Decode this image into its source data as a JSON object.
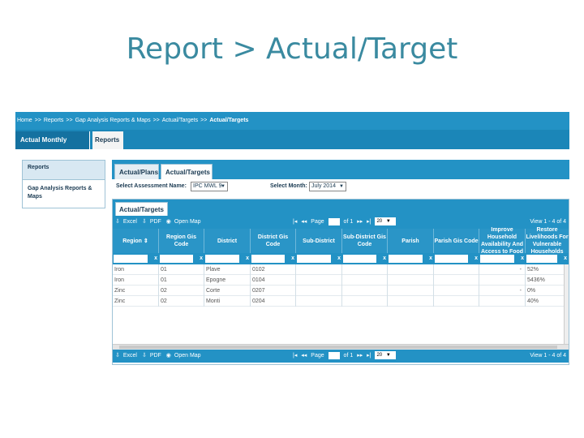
{
  "slide": {
    "title": "Report  > Actual/Target"
  },
  "breadcrumb": [
    "Home",
    "Reports",
    "Gap Analysis Reports & Maps",
    "Actual/Targets",
    "Actual/Targets"
  ],
  "main_tabs": [
    "Actual Monthly Update",
    "Reports"
  ],
  "sidebar": {
    "items": [
      "Reports",
      "Gap Analysis Reports & Maps"
    ]
  },
  "sub_tabs": [
    "Actual/Plans",
    "Actual/Targets"
  ],
  "filters": {
    "assessment_label": "Select Assessment Name:",
    "assessment_value": "IPC MWL 9",
    "month_label": "Select Month:",
    "month_value": "July 2014"
  },
  "grid": {
    "caption": "Actual/Targets",
    "toolbar": {
      "excel": "Excel",
      "pdf": "PDF",
      "open_map": "Open Map",
      "page_label": "Page",
      "of_label": "of 1",
      "page_size": "20",
      "view_label": "View 1 - 4 of 4"
    },
    "columns": [
      "Region",
      "Region Gis Code",
      "District",
      "District Gis Code",
      "Sub-District",
      "Sub-District Gis Code",
      "Parish",
      "Parish Gis Code",
      "Improve Household Availability And Access to Food",
      "Restore Livelihoods For Vulnerable Households"
    ],
    "filter_clear": "x",
    "rows": [
      [
        "Iron",
        "01",
        "Plave",
        "0102",
        "",
        "",
        "",
        "",
        "-",
        "52%"
      ],
      [
        "Iron",
        "01",
        "Epogne",
        "0104",
        "",
        "",
        "",
        "",
        "",
        "5436%"
      ],
      [
        "Zinc",
        "02",
        "Corte",
        "0207",
        "",
        "",
        "",
        "",
        "-",
        "0%"
      ],
      [
        "Zinc",
        "02",
        "Monti",
        "0204",
        "",
        "",
        "",
        "",
        "",
        "40%"
      ]
    ]
  },
  "colors": {
    "header_blue": "#2392c5",
    "title_teal": "#3a8aa0"
  }
}
